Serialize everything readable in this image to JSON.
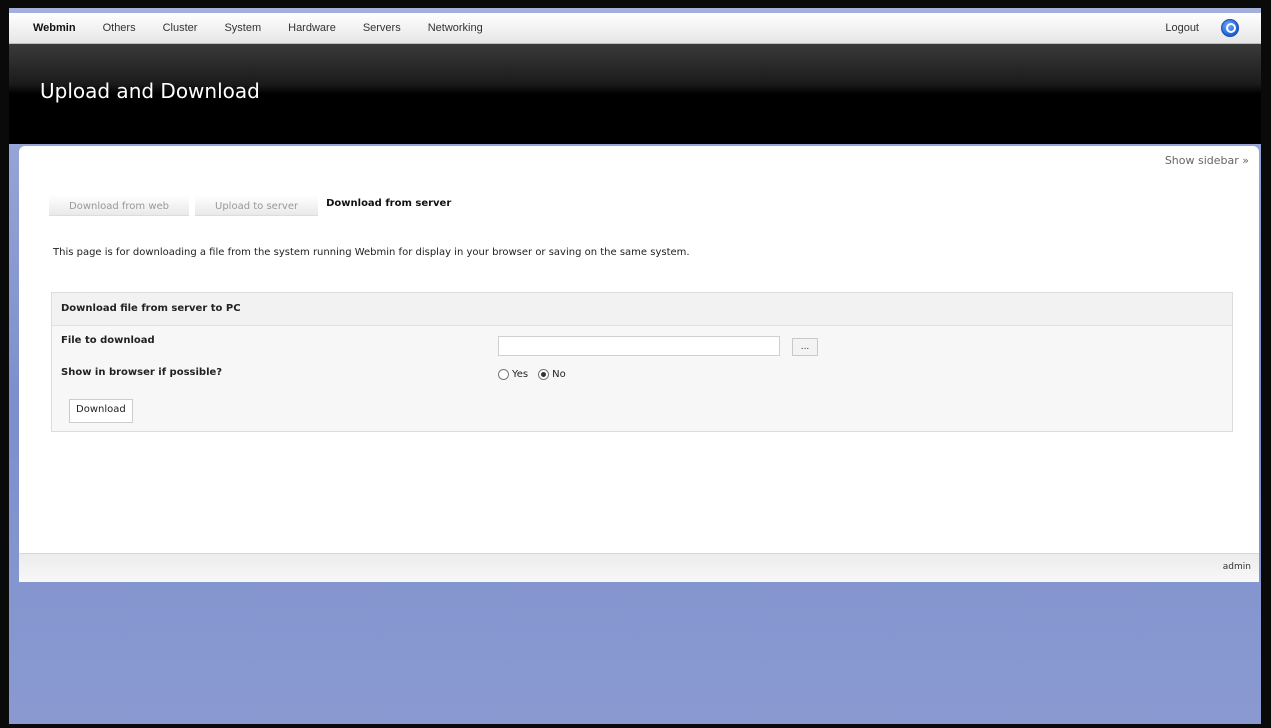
{
  "nav": {
    "brand": "Webmin",
    "items": [
      "Others",
      "Cluster",
      "System",
      "Hardware",
      "Servers",
      "Networking"
    ],
    "logout": "Logout"
  },
  "header": {
    "title": "Upload and Download"
  },
  "panel": {
    "show_sidebar": "Show sidebar »",
    "tabs": [
      "Download from web",
      "Upload to server",
      "Download from server"
    ],
    "intro": "This page is for downloading a file from the system running Webmin for display in your browser or saving on the same system.",
    "form": {
      "title": "Download file from server to PC",
      "file_label": "File to download",
      "file_value": "",
      "browse_label": "...",
      "show_label": "Show in browser if possible?",
      "option_yes": "Yes",
      "option_no": "No",
      "selected": "No",
      "submit": "Download"
    }
  },
  "footer": {
    "user": "admin"
  }
}
